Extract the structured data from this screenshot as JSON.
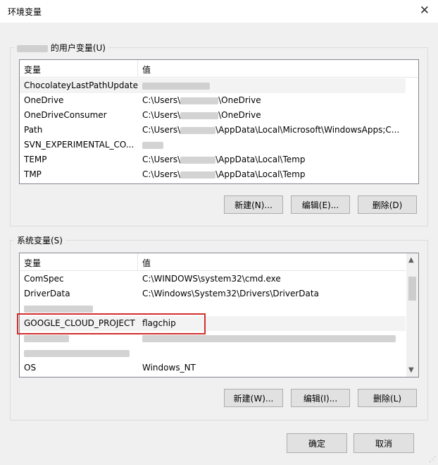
{
  "window": {
    "title": "环境变量",
    "close_glyph": "✕"
  },
  "user_section": {
    "title_suffix": "的用户变量(U)",
    "columns": {
      "name": "变量",
      "value": "值"
    },
    "rows": [
      {
        "name": "ChocolateyLastPathUpdate",
        "value": ""
      },
      {
        "name": "OneDrive",
        "value_prefix": "C:\\Users\\",
        "value_suffix": "\\OneDrive"
      },
      {
        "name": "OneDriveConsumer",
        "value_prefix": "C:\\Users\\",
        "value_suffix": "\\OneDrive"
      },
      {
        "name": "Path",
        "value_prefix": "C:\\Users\\",
        "value_suffix": "\\AppData\\Local\\Microsoft\\WindowsApps;C..."
      },
      {
        "name": "SVN_EXPERIMENTAL_CO...",
        "value": ""
      },
      {
        "name": "TEMP",
        "value_prefix": "C:\\Users\\",
        "value_suffix": "\\AppData\\Local\\Temp"
      },
      {
        "name": "TMP",
        "value_prefix": "C:\\Users\\",
        "value_suffix": "\\AppData\\Local\\Temp"
      }
    ],
    "buttons": {
      "new": "新建(N)...",
      "edit": "编辑(E)...",
      "delete": "删除(D)"
    }
  },
  "system_section": {
    "title": "系统变量(S)",
    "columns": {
      "name": "变量",
      "value": "值"
    },
    "rows": [
      {
        "name": "ComSpec",
        "value": "C:\\WINDOWS\\system32\\cmd.exe"
      },
      {
        "name": "DriverData",
        "value": "C:\\Windows\\System32\\Drivers\\DriverData"
      },
      {
        "name": "",
        "value": ""
      },
      {
        "name": "GOOGLE_CLOUD_PROJECT",
        "value": "flagchip"
      },
      {
        "name": "",
        "value": ""
      },
      {
        "name": "",
        "value": ""
      },
      {
        "name": "OS",
        "value": "Windows_NT"
      }
    ],
    "buttons": {
      "new": "新建(W)...",
      "edit": "编辑(I)...",
      "delete": "删除(L)"
    }
  },
  "footer": {
    "ok": "确定",
    "cancel": "取消"
  },
  "colors": {
    "highlight": "#d32f2f",
    "selected_row": "#f3f3f3"
  }
}
